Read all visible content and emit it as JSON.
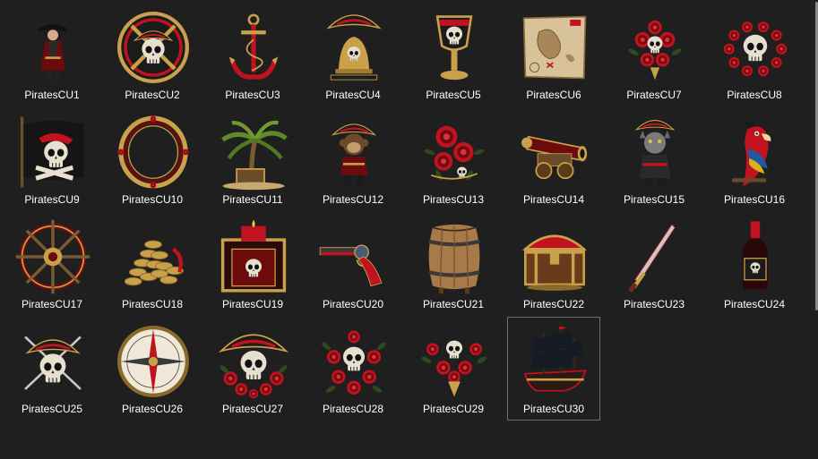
{
  "items": [
    {
      "label": "PiratesCU1",
      "icon": "pirate-woman-icon"
    },
    {
      "label": "PiratesCU2",
      "icon": "skull-medallion-icon"
    },
    {
      "label": "PiratesCU3",
      "icon": "anchor-icon"
    },
    {
      "label": "PiratesCU4",
      "icon": "ship-bell-icon"
    },
    {
      "label": "PiratesCU5",
      "icon": "skull-goblet-icon"
    },
    {
      "label": "PiratesCU6",
      "icon": "treasure-map-icon"
    },
    {
      "label": "PiratesCU7",
      "icon": "rose-skull-bouquet-icon"
    },
    {
      "label": "PiratesCU8",
      "icon": "skull-rose-wreath-icon"
    },
    {
      "label": "PiratesCU9",
      "icon": "jolly-roger-flag-icon"
    },
    {
      "label": "PiratesCU10",
      "icon": "ornate-frame-icon"
    },
    {
      "label": "PiratesCU11",
      "icon": "palm-treasure-icon"
    },
    {
      "label": "PiratesCU12",
      "icon": "pirate-monkey-icon"
    },
    {
      "label": "PiratesCU13",
      "icon": "red-roses-icon"
    },
    {
      "label": "PiratesCU14",
      "icon": "cannon-icon"
    },
    {
      "label": "PiratesCU15",
      "icon": "pirate-cat-icon"
    },
    {
      "label": "PiratesCU16",
      "icon": "parrot-icon"
    },
    {
      "label": "PiratesCU17",
      "icon": "ship-wheel-icon"
    },
    {
      "label": "PiratesCU18",
      "icon": "gold-coins-icon"
    },
    {
      "label": "PiratesCU19",
      "icon": "candle-frame-icon"
    },
    {
      "label": "PiratesCU20",
      "icon": "flintlock-pistol-icon"
    },
    {
      "label": "PiratesCU21",
      "icon": "barrel-icon"
    },
    {
      "label": "PiratesCU22",
      "icon": "treasure-chest-icon"
    },
    {
      "label": "PiratesCU23",
      "icon": "sword-icon"
    },
    {
      "label": "PiratesCU24",
      "icon": "wine-bottle-icon"
    },
    {
      "label": "PiratesCU25",
      "icon": "skull-crossed-swords-icon"
    },
    {
      "label": "PiratesCU26",
      "icon": "compass-icon"
    },
    {
      "label": "PiratesCU27",
      "icon": "skull-hat-roses-icon"
    },
    {
      "label": "PiratesCU28",
      "icon": "skull-rose-bouquet-icon"
    },
    {
      "label": "PiratesCU29",
      "icon": "skull-rose-sprig-icon"
    },
    {
      "label": "PiratesCU30",
      "icon": "pirate-ship-icon"
    }
  ],
  "selected_item": "PiratesCU30",
  "colors": {
    "background": "#1f1f1f",
    "label_text": "#ffffff",
    "selection_border": "#6e6e6e",
    "gold": "#c9a14a",
    "red": "#c1121f",
    "bone": "#e8e0cf",
    "dark": "#121212"
  }
}
